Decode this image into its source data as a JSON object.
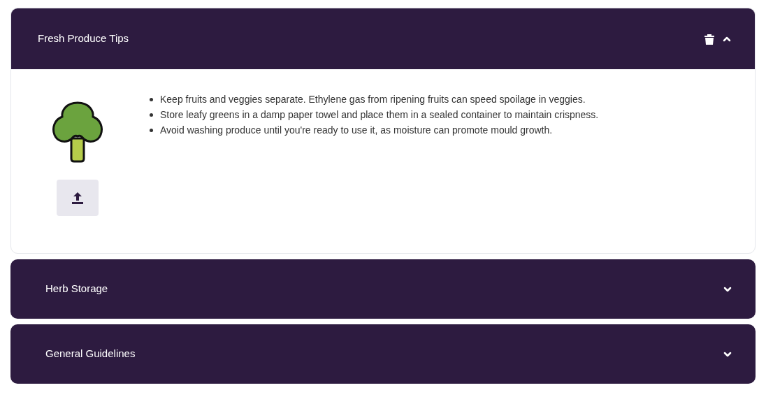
{
  "sections": [
    {
      "title": "Fresh Produce Tips",
      "expanded": true,
      "tips": [
        "Keep fruits and veggies separate. Ethylene gas from ripening fruits can speed spoilage in veggies.",
        "Store leafy greens in a damp paper towel and place them in a sealed container to maintain crispness.",
        "Avoid washing produce until you're ready to use it, as moisture can promote mould growth."
      ]
    },
    {
      "title": "Herb Storage",
      "expanded": false
    },
    {
      "title": "General Guidelines",
      "expanded": false
    }
  ]
}
